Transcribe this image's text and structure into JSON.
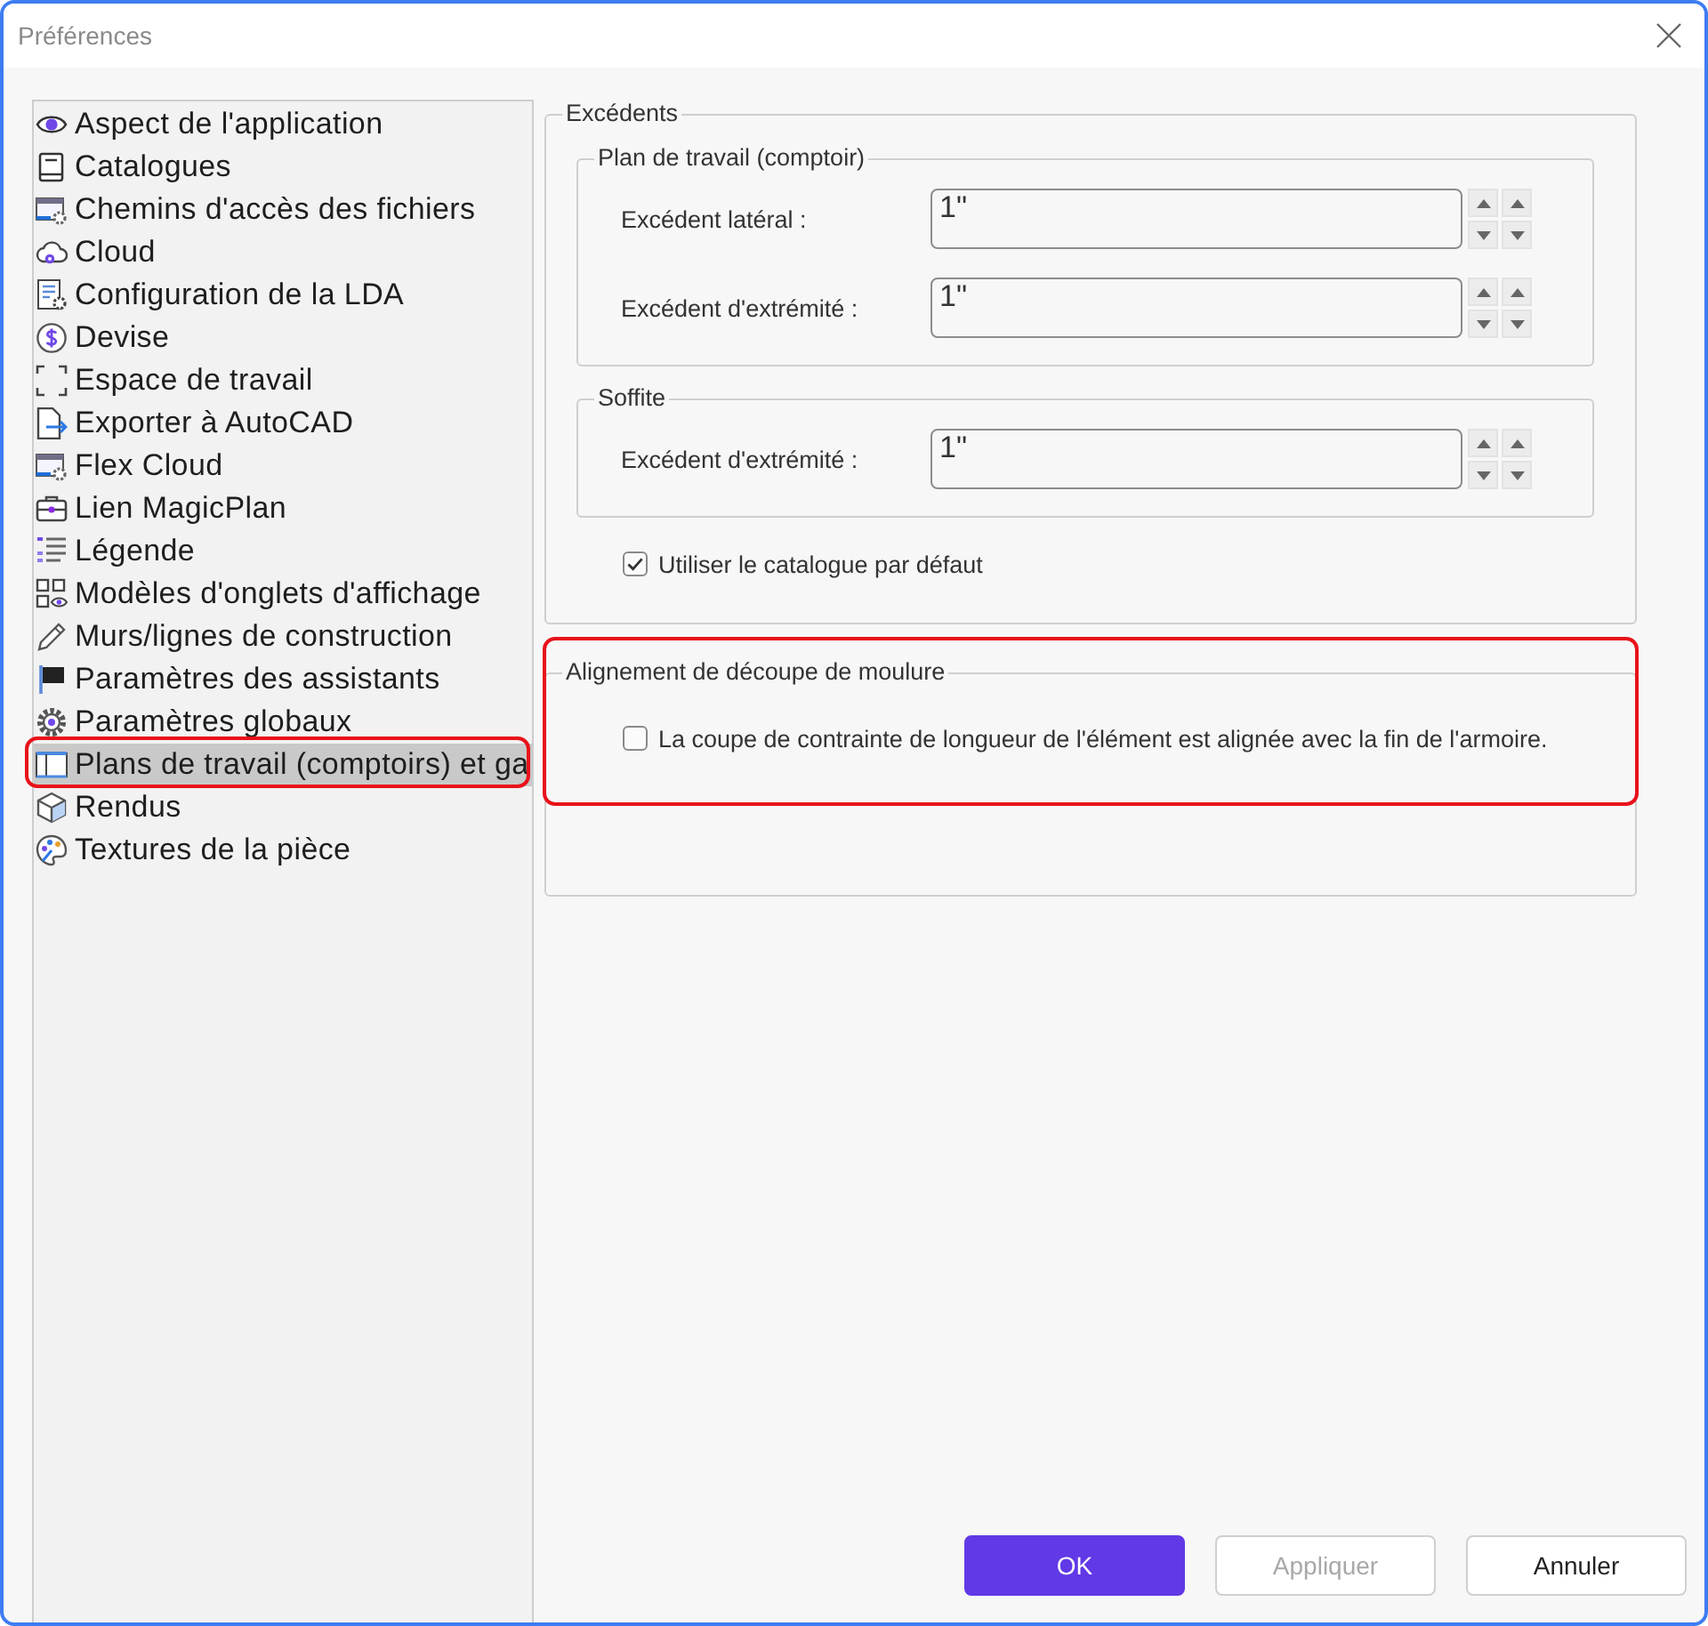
{
  "window": {
    "title": "Préférences"
  },
  "sidebar": {
    "items": [
      {
        "label": "Aspect de l'application",
        "selected": false,
        "highlighted": false
      },
      {
        "label": "Catalogues",
        "selected": false,
        "highlighted": false
      },
      {
        "label": "Chemins d'accès des fichiers",
        "selected": false,
        "highlighted": false
      },
      {
        "label": "Cloud",
        "selected": false,
        "highlighted": false
      },
      {
        "label": "Configuration de la LDA",
        "selected": false,
        "highlighted": false
      },
      {
        "label": "Devise",
        "selected": false,
        "highlighted": false
      },
      {
        "label": "Espace de travail",
        "selected": false,
        "highlighted": false
      },
      {
        "label": "Exporter à AutoCAD",
        "selected": false,
        "highlighted": false
      },
      {
        "label": "Flex Cloud",
        "selected": false,
        "highlighted": false
      },
      {
        "label": "Lien MagicPlan",
        "selected": false,
        "highlighted": false
      },
      {
        "label": "Légende",
        "selected": false,
        "highlighted": false
      },
      {
        "label": "Modèles d'onglets d'affichage",
        "selected": false,
        "highlighted": false
      },
      {
        "label": "Murs/lignes de construction",
        "selected": false,
        "highlighted": false
      },
      {
        "label": "Paramètres des assistants",
        "selected": false,
        "highlighted": false
      },
      {
        "label": "Paramètres globaux",
        "selected": false,
        "highlighted": false
      },
      {
        "label": "Plans de travail (comptoirs) et ga",
        "selected": true,
        "highlighted": true
      },
      {
        "label": "Rendus",
        "selected": false,
        "highlighted": false
      },
      {
        "label": "Textures de la pièce",
        "selected": false,
        "highlighted": false
      }
    ]
  },
  "groups": [
    {
      "title": "Excédents",
      "highlighted": false,
      "subgroups": [
        {
          "title": "Plan de travail (comptoir)",
          "fields": [
            {
              "label": "Excédent latéral :",
              "value": "1\""
            },
            {
              "label": "Excédent d'extrémité :",
              "value": "1\""
            }
          ]
        },
        {
          "title": "Soffite",
          "fields": [
            {
              "label": "Excédent d'extrémité :",
              "value": "1\""
            }
          ]
        }
      ],
      "checkboxes": [
        {
          "label": "Utiliser le catalogue par défaut",
          "checked": true
        }
      ]
    },
    {
      "title": "Alignement de découpe de moulure",
      "highlighted": true,
      "checkboxes": [
        {
          "label": "La coupe de contrainte de longueur de l'élément est alignée avec la fin de l'armoire.",
          "checked": false
        }
      ]
    }
  ],
  "buttons": [
    {
      "label": "OK",
      "kind": "primary",
      "disabled": false
    },
    {
      "label": "Appliquer",
      "kind": "default",
      "disabled": true
    },
    {
      "label": "Annuler",
      "kind": "default",
      "disabled": false
    }
  ]
}
